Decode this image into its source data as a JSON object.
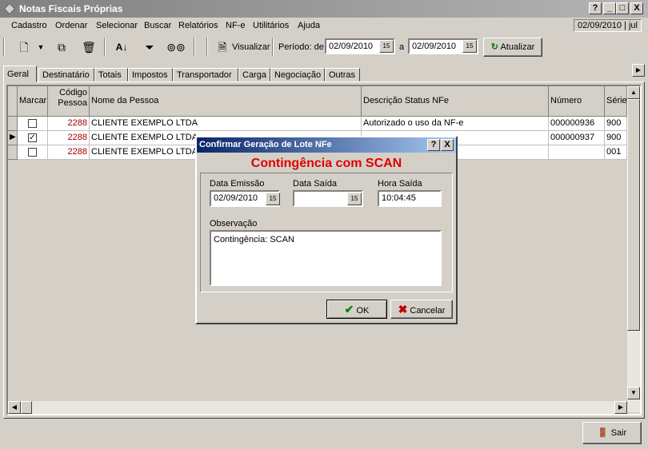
{
  "window": {
    "title": "Notas Fiscais Próprias",
    "help_btn": "?",
    "min_btn": "_",
    "max_btn": "□",
    "close_btn": "X"
  },
  "menu": {
    "items": [
      "Cadastro",
      "Ordenar",
      "Selecionar",
      "Buscar",
      "Relatórios",
      "NF-e",
      "Utilitários",
      "Ajuda"
    ],
    "date_display": "02/09/2010 | jul"
  },
  "toolbar": {
    "visualizar": "Visualizar",
    "periodo_label": "Período: de",
    "date_from": "02/09/2010",
    "a_label": "a",
    "date_to": "02/09/2010",
    "atualizar": "Atualizar",
    "cal_icon": "15"
  },
  "tabs": [
    "Geral",
    "Destinatário",
    "Totais",
    "Impostos",
    "Transportador",
    "Carga",
    "Negociação",
    "Outras"
  ],
  "grid": {
    "headers": {
      "marcar": "Marcar",
      "codigo": "Código Pessoa",
      "nome": "Nome da Pessoa",
      "status": "Descrição Status NFe",
      "numero": "Número",
      "serie": "Série"
    },
    "rows": [
      {
        "checked": "",
        "codigo": "2288",
        "nome": "CLIENTE EXEMPLO LTDA",
        "status": "Autorizado o uso da NF-e",
        "numero": "000000936",
        "serie": "900"
      },
      {
        "checked": "✓",
        "codigo": "2288",
        "nome": "CLIENTE EXEMPLO LTDA",
        "status": "",
        "numero": "000000937",
        "serie": "900"
      },
      {
        "checked": "",
        "codigo": "2288",
        "nome": "CLIENTE EXEMPLO LTDA",
        "status": "",
        "numero": "",
        "serie": "001"
      }
    ]
  },
  "dialog": {
    "title": "Confirmar Geração de Lote NFe",
    "help_btn": "?",
    "close_btn": "X",
    "heading": "Contingência com SCAN",
    "data_emissao_label": "Data Emissão",
    "data_emissao": "02/09/2010",
    "data_saida_label": "Data Saída",
    "data_saida": "",
    "hora_saida_label": "Hora Saída",
    "hora_saida": "10:04:45",
    "observacao_label": "Observação",
    "observacao": "Contingência: SCAN",
    "ok": "OK",
    "cancelar": "Cancelar",
    "heading_color": "#e00000"
  },
  "footer": {
    "sair": "Sair"
  },
  "colors": {
    "code_text": "#a00000",
    "title_bar": "#0a246a"
  }
}
